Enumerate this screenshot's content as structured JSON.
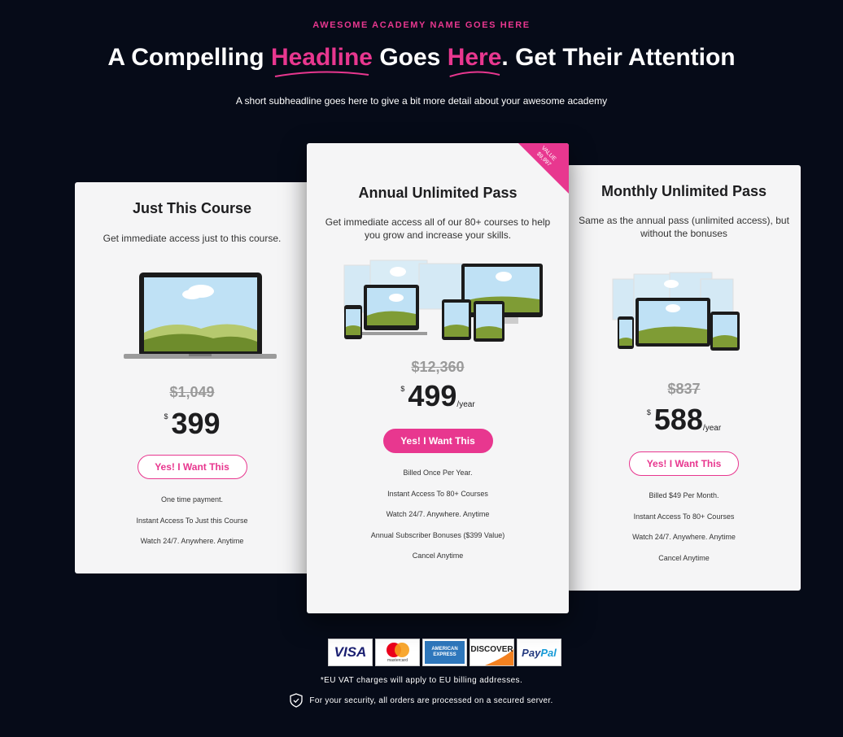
{
  "hero": {
    "eyebrow": "AWESOME ACADEMY NAME GOES HERE",
    "headline_part1": "A Compelling ",
    "headline_hl1": "Headline",
    "headline_part2": " Goes ",
    "headline_hl2": "Here",
    "headline_part3": ". Get Their Attention",
    "subheadline": "A short subheadline goes here to give a bit more detail about your awesome academy"
  },
  "plans": [
    {
      "title": "Just This Course",
      "description": "Get immediate access just to this course.",
      "image_icon": "laptop-icon",
      "old_price": "$1,049",
      "currency": "$",
      "price": "399",
      "period": "",
      "button": "Yes! I Want This",
      "features": [
        "One time payment.",
        "Instant Access To Just this Course",
        "Watch 24/7. Anywhere. Anytime"
      ]
    },
    {
      "title": "Annual Unlimited Pass",
      "description": "Get immediate access all of our 80+ courses to help you grow and increase your skills.",
      "image_icon": "devices-icon",
      "ribbon_line1": "VALUE",
      "ribbon_line2": "$9,997",
      "old_price": "$12,360",
      "currency": "$",
      "price": "499",
      "period": "/year",
      "button": "Yes! I Want This",
      "features": [
        "Billed Once Per Year.",
        "Instant Access To 80+ Courses",
        "Watch 24/7. Anywhere. Anytime",
        "Annual Subscriber Bonuses ($399 Value)",
        "Cancel Anytime"
      ]
    },
    {
      "title": "Monthly Unlimited Pass",
      "description": "Same as the annual pass (unlimited access), but without the bonuses",
      "image_icon": "devices-icon",
      "old_price": "$837",
      "currency": "$",
      "price": "588",
      "period": "/year",
      "button": "Yes! I Want This",
      "features": [
        "Billed $49 Per Month.",
        "Instant Access To 80+ Courses",
        "Watch 24/7. Anywhere. Anytime",
        "Cancel Anytime"
      ]
    }
  ],
  "payment": {
    "visa": "VISA",
    "mastercard": "mastercard",
    "amex_line1": "AMERICAN",
    "amex_line2": "EXPRESS",
    "discover": "DISCOVER",
    "paypal_a": "Pay",
    "paypal_b": "Pal"
  },
  "footer": {
    "vat_note": "*EU VAT charges will apply to EU billing addresses.",
    "security_note": "For your security, all orders are processed on a secured server."
  },
  "colors": {
    "background": "#060b18",
    "accent": "#e8378f",
    "card": "#f5f5f6"
  }
}
